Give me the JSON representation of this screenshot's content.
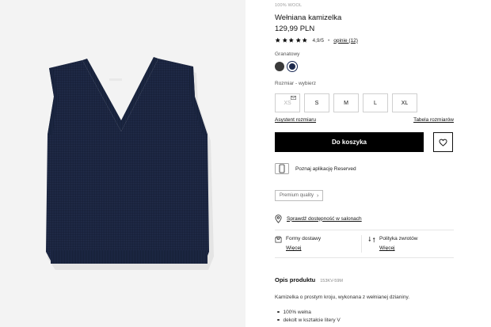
{
  "product": {
    "material_tag": "100% WOOL",
    "title": "Wełniana kamizelka",
    "price": "129,99 PLN",
    "rating": 4.9,
    "rating_text": "4,9/5",
    "rating_separator": "•",
    "reviews_link": "opinie (12)",
    "image_alt": "Navy wool V-neck sweater vest"
  },
  "color": {
    "label": "Granatowy",
    "swatches": [
      {
        "name": "gray",
        "hex": "#3a3a3a"
      },
      {
        "name": "navy",
        "hex": "#1d2a4d",
        "selected": true
      }
    ]
  },
  "size": {
    "label": "Rozmiar -  wybierz",
    "options": [
      {
        "label": "XS",
        "available": false
      },
      {
        "label": "S",
        "available": true
      },
      {
        "label": "M",
        "available": true
      },
      {
        "label": "L",
        "available": true
      },
      {
        "label": "XL",
        "available": true
      }
    ],
    "assistant_link": "Asystent rozmiaru",
    "table_link": "Tabela rozmiarów"
  },
  "actions": {
    "add_to_cart": "Do koszyka",
    "wishlist_icon": "heart-icon"
  },
  "app_promo": {
    "text": "Poznaj aplikację Reserved",
    "icon": "smartphone-icon"
  },
  "premium": {
    "label": "Premium quality",
    "chevron": "›"
  },
  "availability": {
    "link": "Sprawdź dostępność w salonach",
    "icon": "map-pin-icon"
  },
  "shipping": {
    "delivery_label": "Formy dostawy",
    "delivery_more": "Więcej",
    "returns_label": "Polityka zwrotów",
    "returns_more": "Więcej"
  },
  "description": {
    "heading": "Opis produktu",
    "sku": "153KV-59M",
    "text": "Kamizelka o prostym kroju, wykonana z wełnianej dzianiny.",
    "bullets": [
      "100% wełna",
      "dekolt w kształcie litery V"
    ]
  },
  "colors": {
    "button_bg": "#000000",
    "text": "#111111",
    "muted": "#9a9a9a",
    "gallery_bg": "#f3f3f3",
    "garment": "#1b2540"
  }
}
